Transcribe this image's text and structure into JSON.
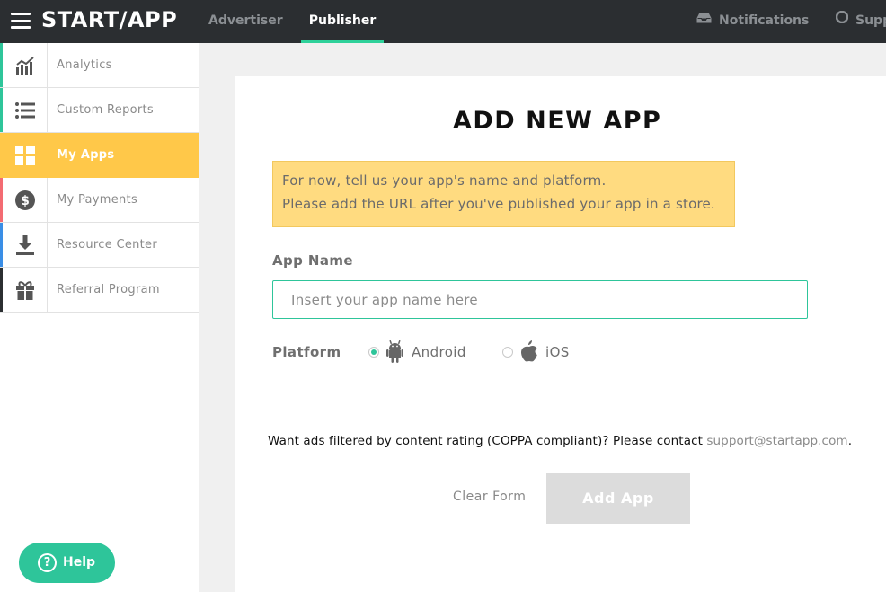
{
  "header": {
    "logo": "START/APP",
    "nav": [
      {
        "label": "Advertiser",
        "active": false
      },
      {
        "label": "Publisher",
        "active": true
      }
    ],
    "notifications_label": "Notifications",
    "support_label": "Supp",
    "accent_color": "#2ed19a"
  },
  "sidebar": {
    "items": [
      {
        "label": "Analytics",
        "icon": "chart-icon",
        "stripe": "#2ec59a",
        "active": false
      },
      {
        "label": "Custom Reports",
        "icon": "list-icon",
        "stripe": "#2ec59a",
        "active": false
      },
      {
        "label": "My Apps",
        "icon": "apps-grid-icon",
        "stripe": "#ffc849",
        "active": true
      },
      {
        "label": "My Payments",
        "icon": "dollar-icon",
        "stripe": "#f36b72",
        "active": false
      },
      {
        "label": "Resource Center",
        "icon": "download-icon",
        "stripe": "#3a8ee6",
        "active": false
      },
      {
        "label": "Referral Program",
        "icon": "gift-icon",
        "stripe": "#2b2e31",
        "active": false
      }
    ],
    "help_label": "Help"
  },
  "form": {
    "title": "ADD NEW APP",
    "notice_line1": "For now, tell us your app's name and platform.",
    "notice_line2": "Please add the URL after you've published your app in a store.",
    "app_name_label": "App Name",
    "app_name_placeholder": "Insert your app name here",
    "app_name_value": "",
    "platform_label": "Platform",
    "platforms": [
      {
        "label": "Android",
        "icon": "android-icon",
        "selected": true
      },
      {
        "label": "iOS",
        "icon": "apple-icon",
        "selected": false
      }
    ],
    "coppa_text": "Want ads filtered by content rating (COPPA compliant)? Please contact",
    "coppa_email": "support@startapp.com",
    "coppa_end": ".",
    "clear_label": "Clear Form",
    "submit_label": "Add App"
  }
}
